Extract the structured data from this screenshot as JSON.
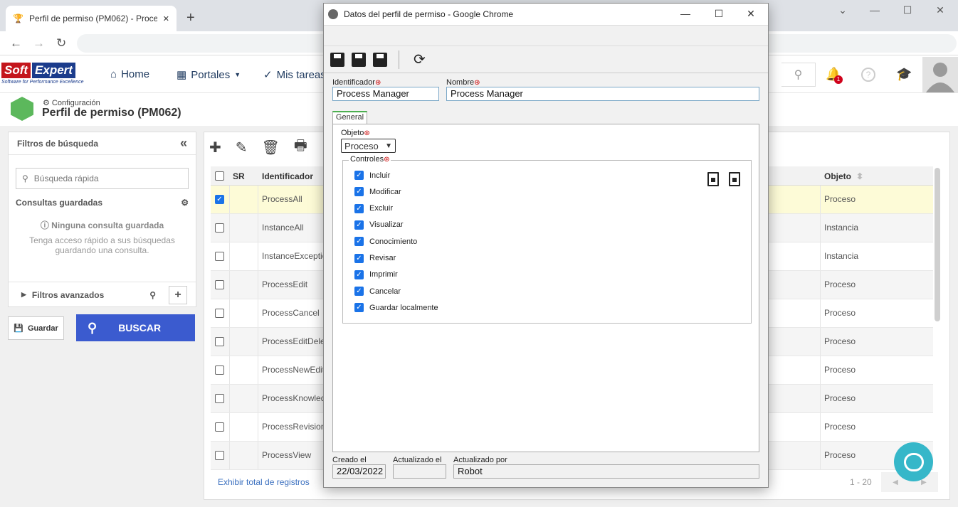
{
  "browser": {
    "tab_title": "Perfil de permiso (PM062) - Proce",
    "new_tab": "+",
    "nav_back": "←",
    "nav_forward": "→",
    "nav_reload": "↻",
    "win_chevron": "⌄",
    "win_min": "—",
    "win_max": "☐",
    "win_close": "✕"
  },
  "app": {
    "logo_soft": "Soft",
    "logo_expert": "Expert",
    "logo_tagline": "Software for Performance Excellence",
    "nav_home": "Home",
    "nav_portales": "Portales",
    "nav_tareas": "Mis tareas",
    "notif_count": "1",
    "help_glyph": "?"
  },
  "page": {
    "breadcrumb": "Configuración",
    "title": "Perfil de permiso (PM062)"
  },
  "filters": {
    "title": "Filtros de búsqueda",
    "collapse": "«",
    "quick_placeholder": "Búsqueda rápida",
    "saved_title": "Consultas guardadas",
    "no_saved": "Ninguna consulta guardada",
    "no_saved_hint": "Tenga acceso rápido a sus búsquedas guardando una consulta.",
    "advanced": "Filtros avanzados",
    "add": "+"
  },
  "buttons": {
    "guardar": "Guardar",
    "buscar": "BUSCAR"
  },
  "grid": {
    "headers": {
      "sr": "SR",
      "identificador": "Identificador",
      "objeto": "Objeto"
    },
    "rows": [
      {
        "id": "ProcessAll",
        "obj": "Proceso",
        "checked": true
      },
      {
        "id": "InstanceAll",
        "obj": "Instancia",
        "checked": false
      },
      {
        "id": "InstanceExceptio",
        "obj": "Instancia",
        "checked": false
      },
      {
        "id": "ProcessEdit",
        "obj": "Proceso",
        "checked": false
      },
      {
        "id": "ProcessCancel",
        "obj": "Proceso",
        "checked": false
      },
      {
        "id": "ProcessEditDele",
        "obj": "Proceso",
        "checked": false
      },
      {
        "id": "ProcessNewEdit",
        "obj": "Proceso",
        "checked": false
      },
      {
        "id": "ProcessKnowled",
        "obj": "Proceso",
        "checked": false
      },
      {
        "id": "ProcessRevision",
        "obj": "Proceso",
        "checked": false
      },
      {
        "id": "ProcessView",
        "obj": "Proceso",
        "checked": false
      }
    ],
    "exhibit": "Exhibir total de registros",
    "pager": "1 - 20"
  },
  "modal": {
    "title": "Datos del perfil de permiso - Google Chrome",
    "identificador_label": "Identificador",
    "identificador_value": "Process Manager",
    "nombre_label": "Nombre",
    "nombre_value": "Process Manager",
    "tab_general": "General",
    "objeto_label": "Objeto",
    "objeto_value": "Proceso",
    "controles_label": "Controles",
    "controls": [
      "Incluir",
      "Modificar",
      "Excluir",
      "Visualizar",
      "Conocimiento",
      "Revisar",
      "Imprimir",
      "Cancelar",
      "Guardar localmente"
    ],
    "creado_label": "Creado el",
    "creado_value": "22/03/2022",
    "actualizado_label": "Actualizado el",
    "actualizado_value": "",
    "actualizado_por_label": "Actualizado por",
    "actualizado_por_value": "Robot"
  }
}
